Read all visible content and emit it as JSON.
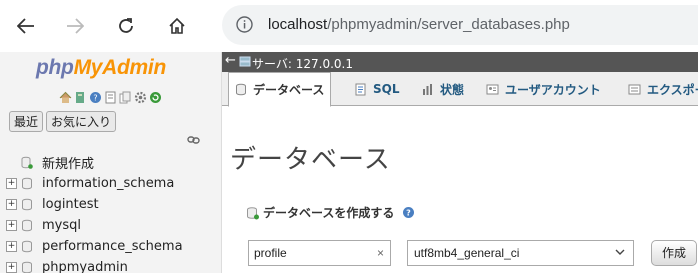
{
  "browser": {
    "url_host": "localhost",
    "url_path": "/phpmyadmin/server_databases.php"
  },
  "nav": {
    "logo_php": "php",
    "logo_myadmin": "MyAdmin",
    "tab_recent": "最近",
    "tab_favorites": "お気に入り",
    "new_label": "新規作成",
    "databases": [
      "information_schema",
      "logintest",
      "mysql",
      "performance_schema",
      "phpmyadmin"
    ]
  },
  "main": {
    "server_label": "サーバ: 127.0.0.1",
    "tabs": [
      "データベース",
      "SQL",
      "状態",
      "ユーザアカウント",
      "エクスポート"
    ],
    "page_title": "データベース",
    "create_heading": "データベースを作成する",
    "db_name_value": "profile",
    "collation_value": "utf8mb4_general_ci",
    "create_button": "作成"
  },
  "colors": {
    "logo_php": "#6c78af",
    "logo_myadmin": "#f89406",
    "server_bar": "#555555",
    "link_blue": "#235a81"
  }
}
